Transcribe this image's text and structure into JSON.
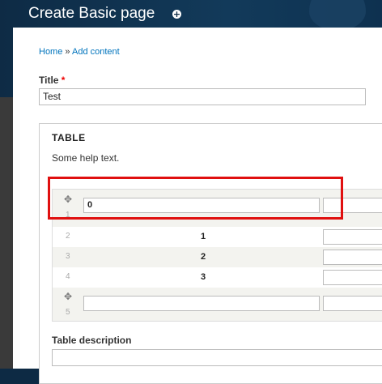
{
  "header": {
    "title": "Create Basic page",
    "add_shortcut_icon": "plus-circle-icon"
  },
  "breadcrumb": {
    "home": "Home",
    "separator": "»",
    "add_content": "Add content"
  },
  "title_field": {
    "label": "Title",
    "required_mark": "*",
    "value": "Test"
  },
  "table_field": {
    "legend": "TABLE",
    "help": "Some help text.",
    "rows": [
      {
        "weight": "1",
        "cell1": "0",
        "cell1_editable": true
      },
      {
        "weight": "2",
        "cell1": "1",
        "cell1_editable": false
      },
      {
        "weight": "3",
        "cell1": "2",
        "cell1_editable": false
      },
      {
        "weight": "4",
        "cell1": "3",
        "cell1_editable": false
      },
      {
        "weight": "5",
        "cell1": "",
        "cell1_editable": true
      }
    ]
  },
  "table_description": {
    "label": "Table description",
    "value": ""
  },
  "colors": {
    "header": "#0e2b45",
    "link": "#0074bd",
    "highlight": "#e01010"
  }
}
